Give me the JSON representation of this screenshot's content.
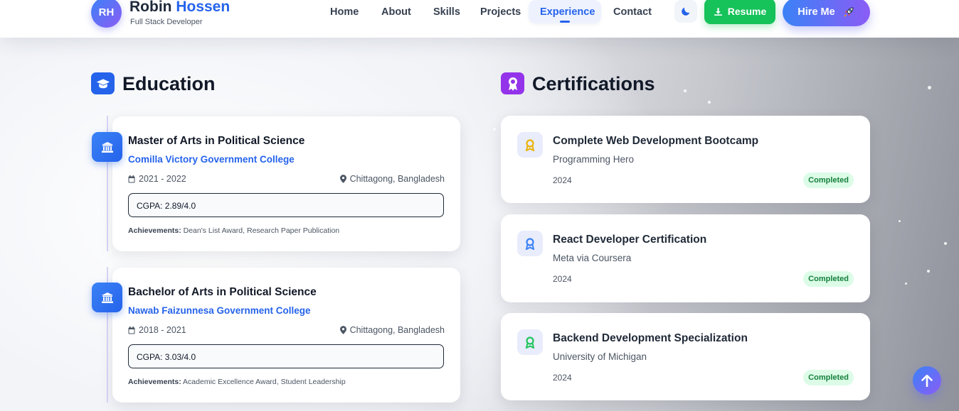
{
  "navbar": {
    "logo_initials": "RH",
    "brand_first": "Robin",
    "brand_last": "Hossen",
    "brand_role": "Full Stack Developer",
    "links": [
      "Home",
      "About",
      "Skills",
      "Projects",
      "Experience",
      "Contact"
    ],
    "active_link": "Experience",
    "resume_label": "Resume",
    "hire_label": "Hire Me"
  },
  "education": {
    "title": "Education",
    "items": [
      {
        "degree": "Master of Arts in Political Science",
        "school": "Comilla Victory Government College",
        "years": "2021 - 2022",
        "location": "Chittagong, Bangladesh",
        "cgpa": "CGPA: 2.89/4.0",
        "achievements_label": "Achievements:",
        "achievements": "Dean's List Award, Research Paper Publication"
      },
      {
        "degree": "Bachelor of Arts in Political Science",
        "school": "Nawab Faizunnesa Government College",
        "years": "2018 - 2021",
        "location": "Chittagong, Bangladesh",
        "cgpa": "CGPA: 3.03/4.0",
        "achievements_label": "Achievements:",
        "achievements": "Academic Excellence Award, Student Leadership"
      }
    ]
  },
  "certifications": {
    "title": "Certifications",
    "items": [
      {
        "title": "Complete Web Development Bootcamp",
        "issuer": "Programming Hero",
        "year": "2024",
        "status": "Completed",
        "icon_color": "#eab308"
      },
      {
        "title": "React Developer Certification",
        "issuer": "Meta via Coursera",
        "year": "2024",
        "status": "Completed",
        "icon_color": "#3b82f6"
      },
      {
        "title": "Backend Development Specialization",
        "issuer": "University of Michigan",
        "year": "2024",
        "status": "Completed",
        "icon_color": "#22c55e"
      }
    ]
  },
  "colors": {
    "accent": "#2563eb",
    "gradient_start": "#3b82f6",
    "gradient_end": "#8b5cf6",
    "resume_green": "#16c25a",
    "status_bg": "#dcfce7",
    "status_text": "#15803d"
  }
}
